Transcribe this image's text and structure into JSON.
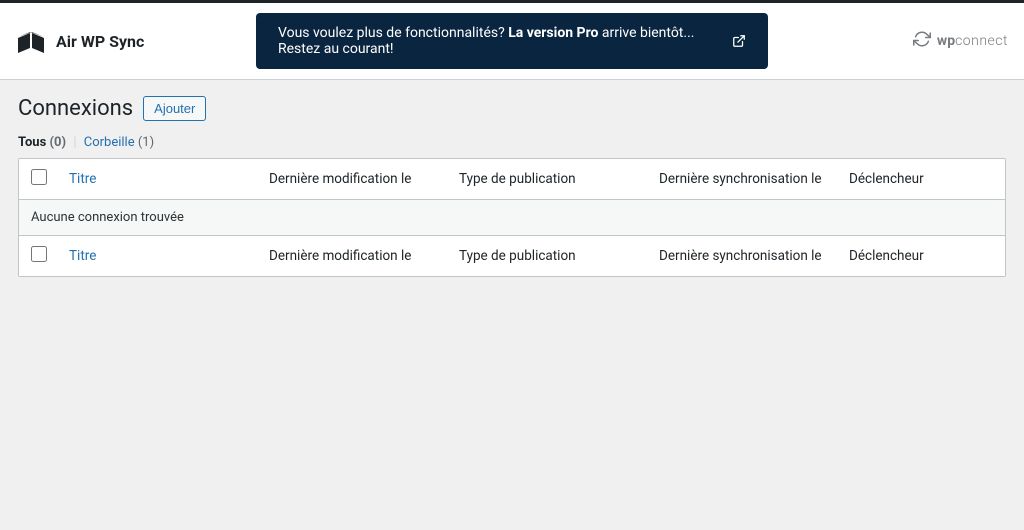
{
  "header": {
    "brand": "Air WP Sync",
    "promo_prefix": "Vous voulez plus de fonctionnalités? ",
    "promo_bold": "La version Pro",
    "promo_suffix": " arrive bientôt... Restez au courant!",
    "wpconnect_prefix": "wp",
    "wpconnect_suffix": "connect"
  },
  "page": {
    "title": "Connexions",
    "add_label": "Ajouter"
  },
  "filters": {
    "all_label": "Tous",
    "all_count": "(0)",
    "trash_label": "Corbeille",
    "trash_count": "(1)"
  },
  "columns": {
    "title": "Titre",
    "modified": "Dernière modification le",
    "pubtype": "Type de publication",
    "sync": "Dernière synchronisation le",
    "trigger": "Déclencheur"
  },
  "empty_message": "Aucune connexion trouvée"
}
